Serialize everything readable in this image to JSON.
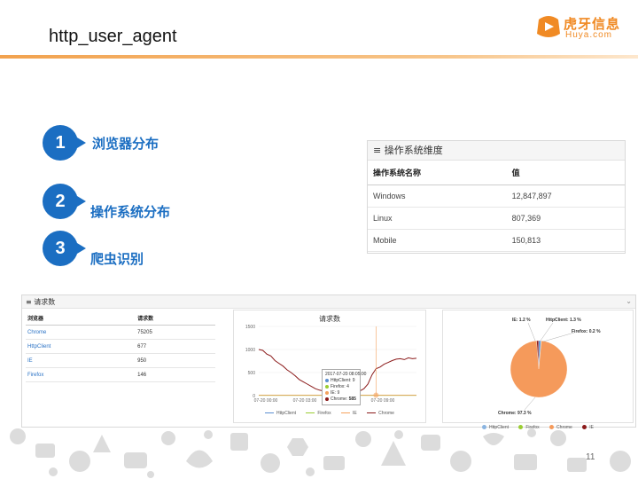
{
  "slide": {
    "title": "http_user_agent",
    "page_number": "11"
  },
  "logo": {
    "cn": "虎牙信息",
    "en": "Huya.com"
  },
  "agenda": [
    {
      "num": "1",
      "label": "浏览器分布"
    },
    {
      "num": "2",
      "label": "操作系统分布"
    },
    {
      "num": "3",
      "label": "爬虫识别"
    }
  ],
  "os_panel": {
    "title": "≡ 操作系统维度",
    "columns": [
      "操作系统名称",
      "值"
    ],
    "rows": [
      [
        "Windows",
        "12,847,897"
      ],
      [
        "Linux",
        "807,369"
      ],
      [
        "Mobile",
        "150,813"
      ]
    ]
  },
  "requests_panel": {
    "title": "≡ 请求数",
    "collapse_icon": "chevron-down-icon",
    "table": {
      "columns": [
        "浏览器",
        "请求数"
      ],
      "rows": [
        [
          "Chrome",
          "75205"
        ],
        [
          "HttpClient",
          "677"
        ],
        [
          "IE",
          "950"
        ],
        [
          "Firefox",
          "146"
        ]
      ]
    }
  },
  "colors": {
    "accent_blue": "#1b6ec2",
    "header_orange": "#f2a24e",
    "httpclient": "#5b8fd1",
    "firefox": "#9acd32",
    "ie": "#f5a25d",
    "chrome": "#8b1a1a",
    "pie_chrome": "#f59a5b"
  },
  "chart_data": [
    {
      "type": "line",
      "title": "请求数",
      "x": [
        "07-20 00:00",
        "07-20 03:00",
        "07-20 06:00",
        "07-20 09:00"
      ],
      "ylim": [
        0,
        1500
      ],
      "yticks": [
        0,
        500,
        1000,
        1500
      ],
      "series": [
        {
          "name": "HttpClient",
          "values": [
            10,
            10,
            10,
            10,
            10,
            10,
            10,
            10,
            10,
            10,
            10,
            10,
            10,
            10,
            10,
            10,
            10,
            10,
            10,
            10,
            10,
            10,
            10,
            10,
            10,
            10,
            10,
            10,
            10,
            10,
            10,
            10,
            10,
            10,
            10,
            10,
            10,
            10,
            10,
            10
          ]
        },
        {
          "name": "Firefox",
          "values": [
            5,
            5,
            5,
            5,
            5,
            5,
            5,
            5,
            5,
            5,
            5,
            5,
            5,
            5,
            5,
            5,
            5,
            5,
            5,
            5,
            5,
            5,
            5,
            5,
            5,
            5,
            5,
            5,
            5,
            5,
            5,
            5,
            5,
            5,
            5,
            5,
            5,
            5,
            5,
            5
          ]
        },
        {
          "name": "IE",
          "values": [
            10,
            10,
            10,
            10,
            10,
            10,
            10,
            10,
            10,
            10,
            10,
            10,
            10,
            10,
            10,
            10,
            10,
            10,
            10,
            10,
            10,
            10,
            10,
            10,
            10,
            10,
            10,
            10,
            10,
            10,
            10,
            10,
            10,
            10,
            10,
            10,
            10,
            10,
            10,
            10
          ]
        },
        {
          "name": "Chrome",
          "values": [
            1000,
            980,
            900,
            860,
            760,
            700,
            640,
            560,
            500,
            430,
            350,
            300,
            250,
            200,
            150,
            120,
            100,
            80,
            70,
            60,
            50,
            55,
            50,
            60,
            80,
            100,
            150,
            250,
            450,
            585,
            620,
            680,
            720,
            760,
            790,
            800,
            780,
            820,
            800,
            810
          ]
        }
      ],
      "tooltip": {
        "time": "2017-07-20 08:05:00",
        "rows": [
          {
            "name": "HttpClient",
            "value": "9"
          },
          {
            "name": "Firefox",
            "value": "4"
          },
          {
            "name": "IE",
            "value": "9"
          },
          {
            "name": "Chrome",
            "value": "585"
          }
        ]
      }
    },
    {
      "type": "pie",
      "slices": [
        {
          "name": "Chrome",
          "value": 97.3,
          "label": "Chrome: 97.3 %"
        },
        {
          "name": "IE",
          "value": 1.2,
          "label": "IE: 1.2 %"
        },
        {
          "name": "HttpClient",
          "value": 1.3,
          "label": "HttpClient: 1.3 %"
        },
        {
          "name": "Firefox",
          "value": 0.2,
          "label": "Firefox: 0.2 %"
        }
      ],
      "legend": [
        "HttpClient",
        "Firefox",
        "Chrome",
        "IE"
      ]
    }
  ]
}
